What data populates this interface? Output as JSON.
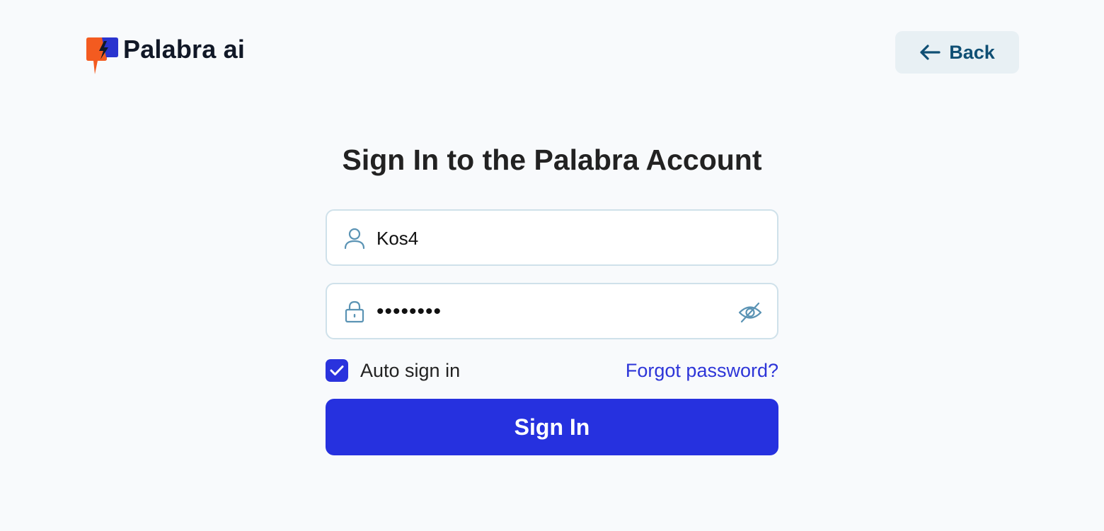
{
  "brand": {
    "name": "Palabra ai",
    "colors": {
      "orange": "#f35b20",
      "blue": "#2a34cf"
    }
  },
  "header": {
    "back_label": "Back",
    "back_icon": "arrow-left-icon"
  },
  "form": {
    "title": "Sign In to the Palabra Account",
    "username": {
      "value": "Kos4",
      "icon": "user-icon"
    },
    "password": {
      "masked_value": "••••••••",
      "icon": "lock-icon",
      "toggle_icon": "eye-off-icon"
    },
    "auto_sign_in": {
      "label": "Auto sign in",
      "checked": true
    },
    "forgot_password_label": "Forgot password?",
    "submit_label": "Sign In"
  },
  "colors": {
    "accent": "#2631df",
    "link": "#2d35d8",
    "field_border": "#cfe1ea",
    "back_bg": "#e8f0f4",
    "back_text": "#0f4f74",
    "icon": "#5a93b4"
  }
}
